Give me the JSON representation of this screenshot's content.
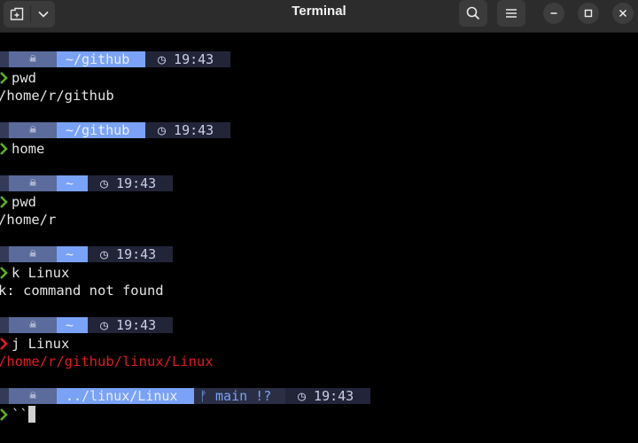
{
  "window": {
    "title": "Terminal",
    "buttons": {
      "new_tab_icon": "new-tab-icon",
      "dropdown_icon": "chevron-down-icon",
      "search_icon": "search-icon",
      "menu_icon": "hamburger-menu-icon",
      "minimize_icon": "minimize-icon",
      "maximize_icon": "maximize-icon",
      "close_icon": "close-icon"
    }
  },
  "colors": {
    "prompt_success": "#5faf2a",
    "prompt_error": "#e01b24",
    "dir_segment": "#7aa2f7",
    "error_output": "#e01b24"
  },
  "terminal": {
    "blocks": [
      {
        "dir": "~/github",
        "time": "◷ 19:43",
        "status": "success",
        "command": "pwd",
        "output": "/home/r/github"
      },
      {
        "dir": "~/github",
        "time": "◷ 19:43",
        "status": "success",
        "command": "home",
        "output": ""
      },
      {
        "dir": "~",
        "time": "◷ 19:43",
        "status": "success",
        "command": "pwd",
        "output": "/home/r"
      },
      {
        "dir": "~",
        "time": "◷ 19:43",
        "status": "success",
        "command": "k Linux",
        "output": "k: command not found"
      },
      {
        "dir": "~",
        "time": "◷ 19:43",
        "status": "error",
        "command": "j Linux",
        "output": "/home/r/github/linux/Linux"
      }
    ],
    "current": {
      "dir": "../linux/Linux",
      "git": "ᚠ main !?",
      "time": "◷ 19:43",
      "status": "success",
      "input": "``"
    }
  }
}
